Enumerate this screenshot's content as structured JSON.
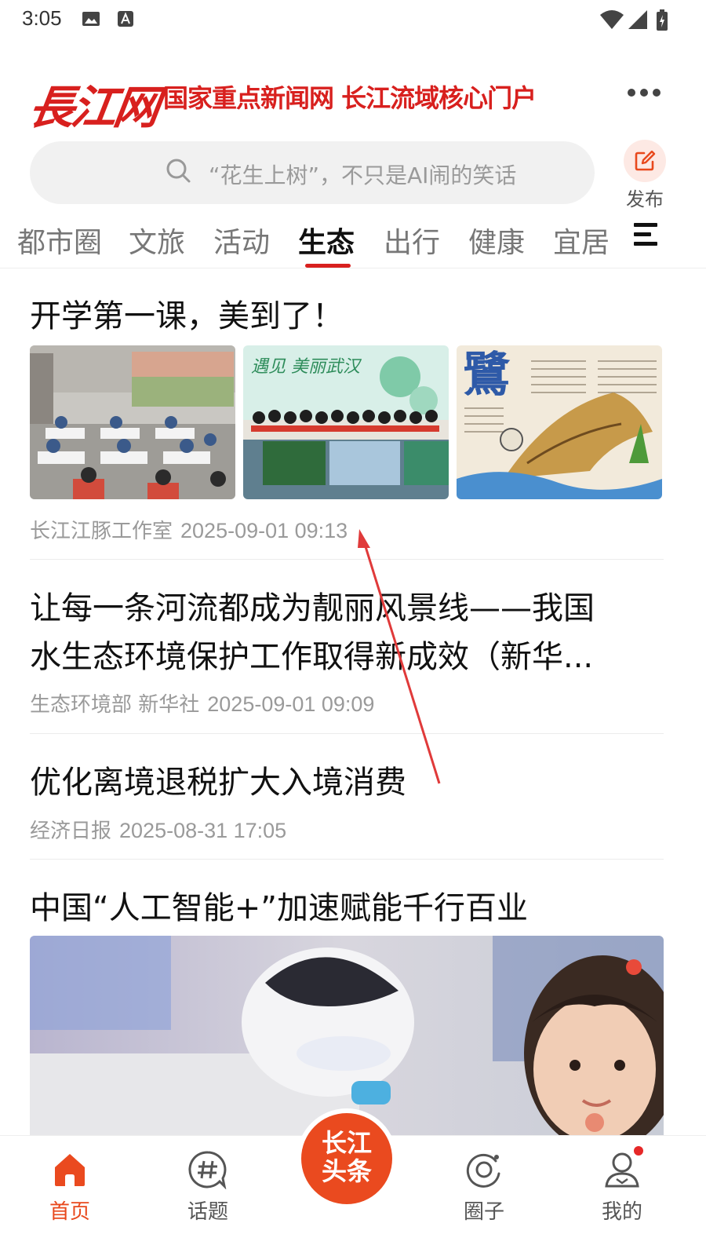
{
  "status_bar": {
    "time": "3:05"
  },
  "header": {
    "logo": "長江网",
    "slogan": "国家重点新闻网 长江流域核心门户"
  },
  "search": {
    "placeholder": "“花生上树”，不只是AI闹的笑话",
    "publish_label": "发布"
  },
  "tabs": [
    {
      "label": "都市圈"
    },
    {
      "label": "文旅"
    },
    {
      "label": "活动"
    },
    {
      "label": "生态",
      "active": true
    },
    {
      "label": "出行"
    },
    {
      "label": "健康"
    },
    {
      "label": "宜居"
    }
  ],
  "articles": [
    {
      "title": "开学第一课，美到了！",
      "source": "长江江豚工作室",
      "date": "2025-09-01 09:13",
      "images": [
        {
          "caption": ""
        },
        {
          "caption": "遇见 美丽武汉"
        },
        {
          "caption": "鷺"
        }
      ]
    },
    {
      "title_line1": "让每一条河流都成为靓丽风景线——我国",
      "title_line2": "水生态环境保护工作取得新成效（新华...",
      "source": "生态环境部 新华社",
      "date": "2025-09-01 09:09"
    },
    {
      "title": "优化离境退税扩大入境消费",
      "source": "经济日报",
      "date": "2025-08-31 17:05"
    },
    {
      "title": "中国“人工智能+”加速赋能千行百业"
    }
  ],
  "bottom_nav": {
    "home": "首页",
    "topics": "话题",
    "center_line1": "长江",
    "center_line2": "头条",
    "circle": "圈子",
    "mine": "我的"
  },
  "colors": {
    "brand_red": "#d8201e",
    "accent_orange": "#ea4a1f",
    "annotation_arrow": "#e03a3a"
  }
}
